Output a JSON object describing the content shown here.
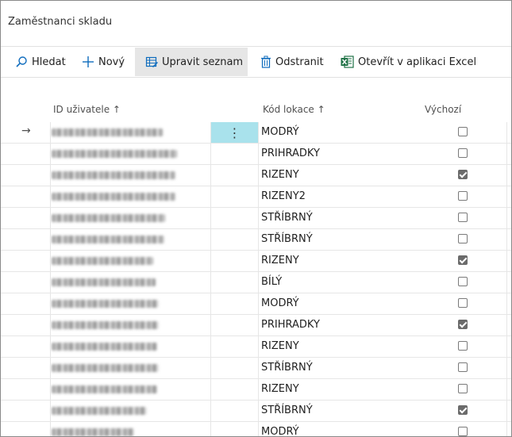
{
  "page": {
    "title": "Zaměstnanci skladu"
  },
  "toolbar": {
    "search_label": "Hledat",
    "new_label": "Nový",
    "edit_list_label": "Upravit seznam",
    "delete_label": "Odstranit",
    "excel_label": "Otevřít v aplikaci Excel",
    "excel_color": "#1e7145"
  },
  "columns": {
    "user_id": "ID uživatele ↑",
    "location_code": "Kód lokace ↑",
    "default": "Výchozí"
  },
  "rows": [
    {
      "location": "MODRÝ",
      "default": false
    },
    {
      "location": "PRIHRADKY",
      "default": false
    },
    {
      "location": "RIZENY",
      "default": true
    },
    {
      "location": "RIZENY2",
      "default": false
    },
    {
      "location": "STŘÍBRNÝ",
      "default": false
    },
    {
      "location": "STŘÍBRNÝ",
      "default": false
    },
    {
      "location": "RIZENY",
      "default": true
    },
    {
      "location": "BÍLÝ",
      "default": false
    },
    {
      "location": "MODRÝ",
      "default": false
    },
    {
      "location": "PRIHRADKY",
      "default": true
    },
    {
      "location": "RIZENY",
      "default": false
    },
    {
      "location": "STŘÍBRNÝ",
      "default": false
    },
    {
      "location": "RIZENY",
      "default": false
    },
    {
      "location": "STŘÍBRNÝ",
      "default": true
    },
    {
      "location": "MODRÝ",
      "default": false
    }
  ],
  "icons": {
    "row_arrow": "→",
    "row_menu": "⋮"
  },
  "colors": {
    "selected_cell": "#a9e2ec",
    "active_button_bg": "#e6e6e6"
  }
}
